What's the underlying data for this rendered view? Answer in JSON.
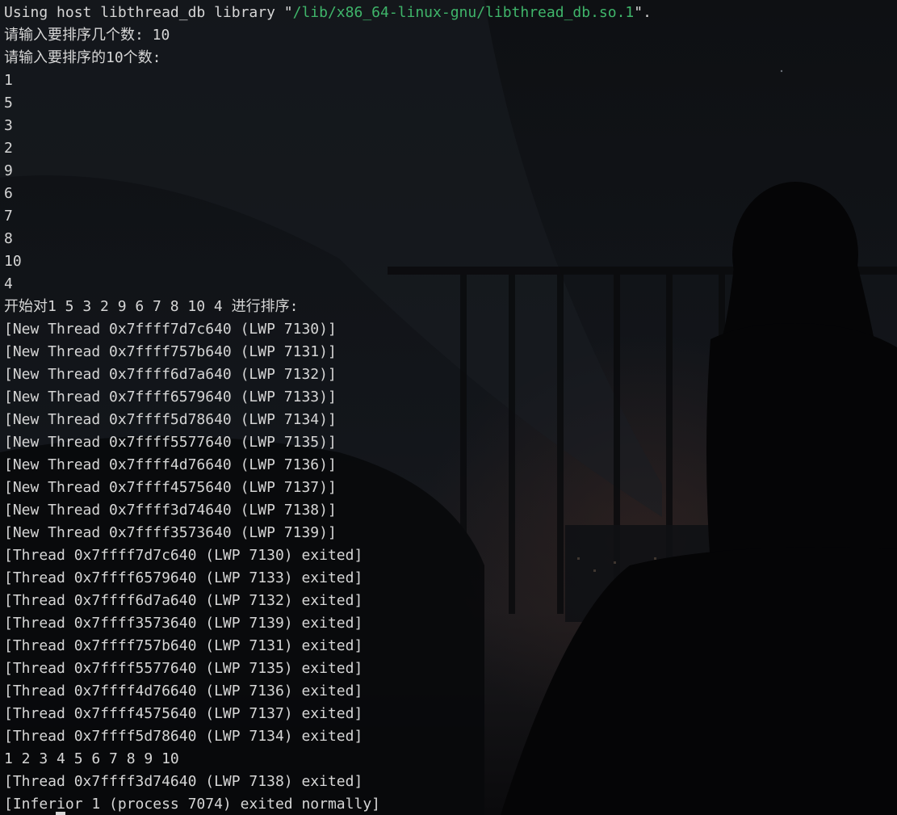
{
  "terminal": {
    "lines": [
      {
        "pre": "Using host libthread_db library \"",
        "path": "/lib/x86_64-linux-gnu/libthread_db.so.1",
        "post": "\"."
      },
      {
        "text": "请输入要排序几个数: 10"
      },
      {
        "text": "请输入要排序的10个数:"
      },
      {
        "text": "1"
      },
      {
        "text": "5"
      },
      {
        "text": "3"
      },
      {
        "text": "2"
      },
      {
        "text": "9"
      },
      {
        "text": "6"
      },
      {
        "text": "7"
      },
      {
        "text": "8"
      },
      {
        "text": "10"
      },
      {
        "text": "4"
      },
      {
        "text": "开始对1 5 3 2 9 6 7 8 10 4 进行排序:"
      },
      {
        "text": "[New Thread 0x7ffff7d7c640 (LWP 7130)]"
      },
      {
        "text": "[New Thread 0x7ffff757b640 (LWP 7131)]"
      },
      {
        "text": "[New Thread 0x7ffff6d7a640 (LWP 7132)]"
      },
      {
        "text": "[New Thread 0x7ffff6579640 (LWP 7133)]"
      },
      {
        "text": "[New Thread 0x7ffff5d78640 (LWP 7134)]"
      },
      {
        "text": "[New Thread 0x7ffff5577640 (LWP 7135)]"
      },
      {
        "text": "[New Thread 0x7ffff4d76640 (LWP 7136)]"
      },
      {
        "text": "[New Thread 0x7ffff4575640 (LWP 7137)]"
      },
      {
        "text": "[New Thread 0x7ffff3d74640 (LWP 7138)]"
      },
      {
        "text": "[New Thread 0x7ffff3573640 (LWP 7139)]"
      },
      {
        "text": "[Thread 0x7ffff7d7c640 (LWP 7130) exited]"
      },
      {
        "text": "[Thread 0x7ffff6579640 (LWP 7133) exited]"
      },
      {
        "text": "[Thread 0x7ffff6d7a640 (LWP 7132) exited]"
      },
      {
        "text": "[Thread 0x7ffff3573640 (LWP 7139) exited]"
      },
      {
        "text": "[Thread 0x7ffff757b640 (LWP 7131) exited]"
      },
      {
        "text": "[Thread 0x7ffff5577640 (LWP 7135) exited]"
      },
      {
        "text": "[Thread 0x7ffff4d76640 (LWP 7136) exited]"
      },
      {
        "text": "[Thread 0x7ffff4575640 (LWP 7137) exited]"
      },
      {
        "text": "[Thread 0x7ffff5d78640 (LWP 7134) exited]"
      },
      {
        "text": "1 2 3 4 5 6 7 8 9 10"
      },
      {
        "text": "[Thread 0x7ffff3d74640 (LWP 7138) exited]"
      },
      {
        "text": "[Inferior 1 (process 7074) exited normally]"
      }
    ]
  },
  "colors": {
    "text": "#d6d6d6",
    "path": "#3fb56a",
    "background": "#0c0d10"
  }
}
